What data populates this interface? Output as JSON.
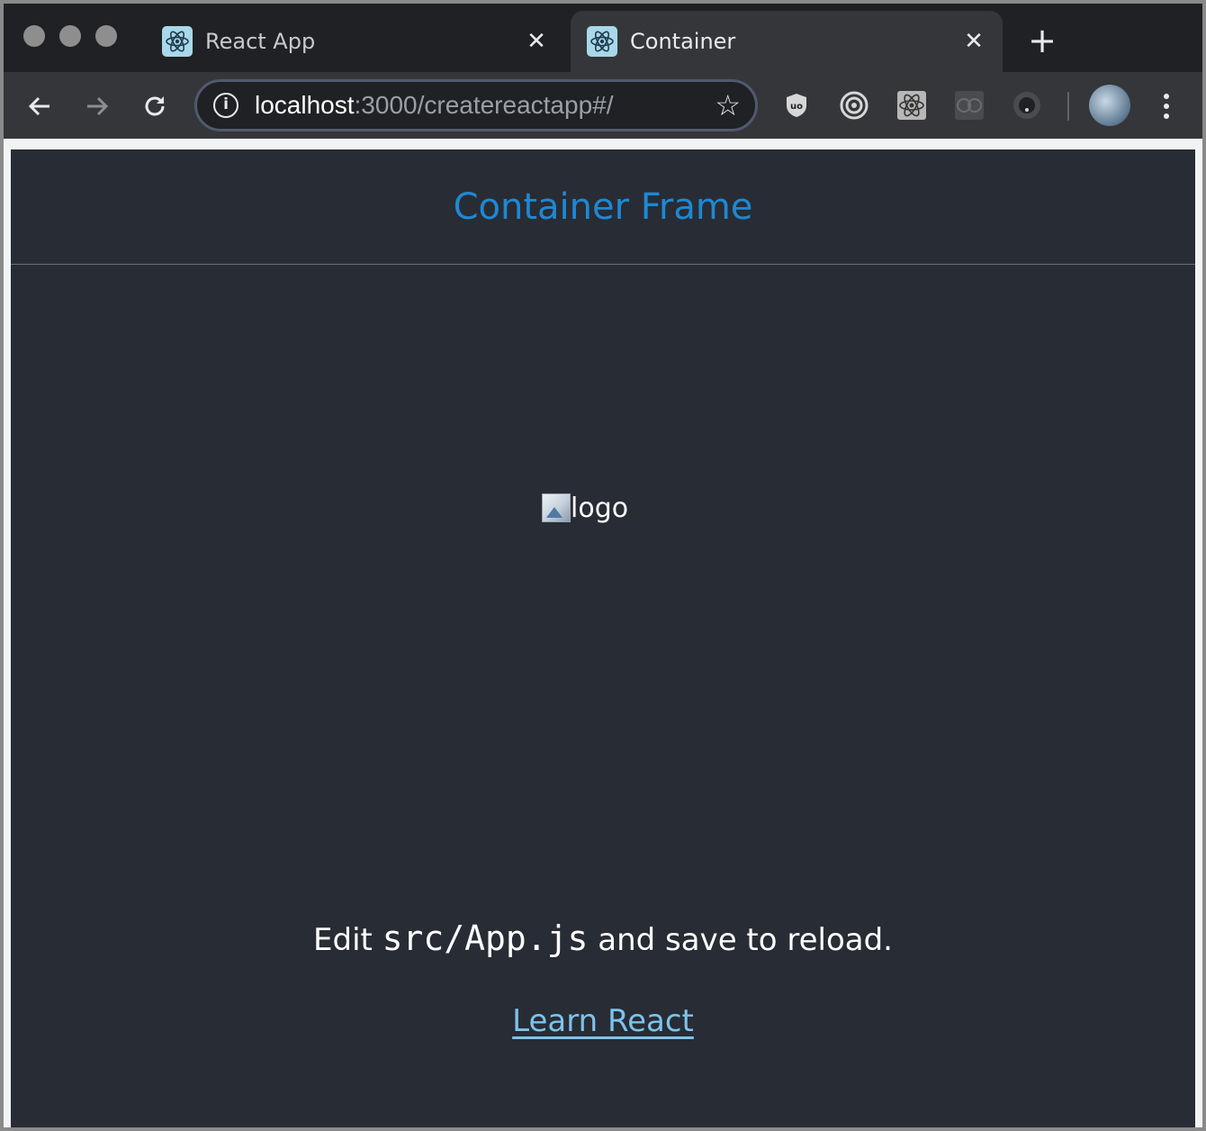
{
  "tabs": [
    {
      "title": "React App",
      "active": false,
      "icon": "react-icon"
    },
    {
      "title": "Container",
      "active": true,
      "icon": "react-icon"
    }
  ],
  "toolbar": {
    "url_host": "localhost",
    "url_path": ":3000/createreactapp#/",
    "extensions": [
      "ublock-origin-icon",
      "target-icon",
      "react-devtools-icon",
      "grid-extension-icon",
      "record-icon"
    ]
  },
  "page": {
    "header_title": "Container Frame",
    "logo_alt": "logo",
    "edit_prefix": "Edit ",
    "edit_code": "src/App.js",
    "edit_suffix": " and save to reload.",
    "learn_link": "Learn React"
  },
  "colors": {
    "page_bg": "#282c34",
    "header_title": "#1e88d4",
    "link": "#7dc3ec",
    "chrome_dark": "#202124",
    "toolbar": "#35363a"
  }
}
